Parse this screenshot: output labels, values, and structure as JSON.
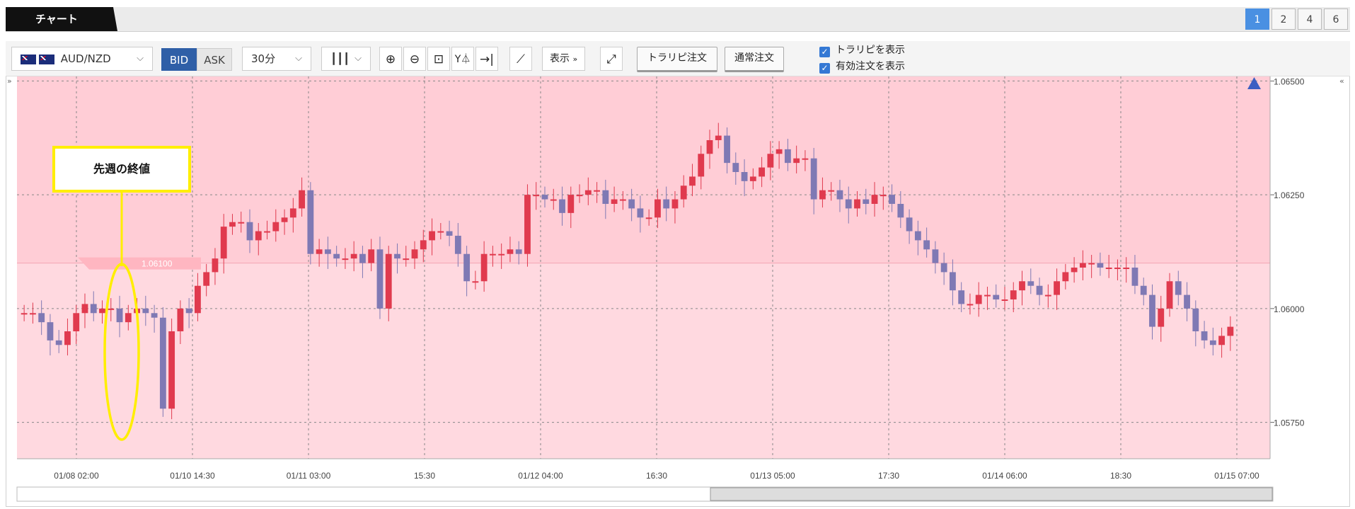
{
  "tabs": {
    "chart_label": "チャート"
  },
  "layout_buttons": [
    "1",
    "2",
    "4",
    "6"
  ],
  "toolbar": {
    "pair": "AUD/NZD",
    "bid_label": "BID",
    "ask_label": "ASK",
    "period": "30分",
    "display_label": "表示",
    "trailing_order_label": "トラリピ注文",
    "normal_order_label": "通常注文",
    "checkbox_show_trailing": "トラリピを表示",
    "checkbox_show_active_orders": "有効注文を表示"
  },
  "icons": {
    "zoom_in": "zoom-in-icon",
    "zoom_out": "zoom-out-icon",
    "fit": "fit-icon",
    "y_axis": "y-axis-icon",
    "scroll_end": "scroll-end-icon",
    "indicator": "indicator-icon",
    "expand": "expand-icon"
  },
  "colors": {
    "up": "#e03a4e",
    "down": "#7f79b4",
    "zone_upper": "#ffcdd6",
    "zone_lower": "#ffd9e0",
    "callout_border": "#ffee00",
    "active_blue": "#4a90e2"
  },
  "annotation": {
    "callout_text": "先週の終値"
  },
  "chart_data": {
    "type": "candlestick",
    "y_ticks": [
      "1.05750",
      "1.06000",
      "1.06250",
      "1.06500"
    ],
    "y_range": [
      1.0567,
      1.0651
    ],
    "x_ticks": [
      "01/08 02:00",
      "01/10 14:30",
      "01/11 03:00",
      "15:30",
      "01/12 04:00",
      "16:30",
      "01/13 05:00",
      "17:30",
      "01/14 06:00",
      "18:30",
      "01/15 07:00"
    ],
    "prev_week_close": 1.061,
    "prev_week_close_label": "1.06100",
    "close": [
      1.0599,
      1.0599,
      1.0597,
      1.0593,
      1.0592,
      1.0595,
      1.0599,
      1.0601,
      1.0599,
      1.06,
      1.06,
      1.0597,
      1.0599,
      1.06,
      1.0599,
      1.0598,
      1.0578,
      1.0595,
      1.06,
      1.0599,
      1.0605,
      1.0608,
      1.0611,
      1.0618,
      1.0619,
      1.0619,
      1.0615,
      1.0617,
      1.0617,
      1.0619,
      1.062,
      1.0622,
      1.0626,
      1.0612,
      1.0613,
      1.0612,
      1.0611,
      1.0611,
      1.0612,
      1.061,
      1.0613,
      1.06,
      1.0612,
      1.0611,
      1.0611,
      1.0613,
      1.0615,
      1.0617,
      1.0617,
      1.0616,
      1.0612,
      1.0606,
      1.0606,
      1.0612,
      1.0612,
      1.0612,
      1.0613,
      1.0612,
      1.0625,
      1.0625,
      1.0624,
      1.0624,
      1.0621,
      1.0625,
      1.0625,
      1.0626,
      1.0626,
      1.0623,
      1.0624,
      1.0624,
      1.0622,
      1.062,
      1.062,
      1.0624,
      1.0622,
      1.0624,
      1.0627,
      1.0629,
      1.0634,
      1.0637,
      1.0638,
      1.0632,
      1.063,
      1.0628,
      1.0629,
      1.0631,
      1.0634,
      1.0635,
      1.0632,
      1.0633,
      1.0633,
      1.0624,
      1.0626,
      1.0626,
      1.0624,
      1.0622,
      1.0624,
      1.0623,
      1.0625,
      1.0625,
      1.0623,
      1.062,
      1.0617,
      1.0615,
      1.0613,
      1.061,
      1.0608,
      1.0604,
      1.0601,
      1.0601,
      1.0603,
      1.0603,
      1.0602,
      1.0602,
      1.0604,
      1.0606,
      1.0605,
      1.0603,
      1.0603,
      1.0606,
      1.0608,
      1.0609,
      1.061,
      1.061,
      1.0609,
      1.0609,
      1.0609,
      1.0609,
      1.0605,
      1.0603,
      1.0596,
      1.06,
      1.0606,
      1.0603,
      1.06,
      1.0595,
      1.0593,
      1.0592,
      1.0594,
      1.0596
    ]
  }
}
